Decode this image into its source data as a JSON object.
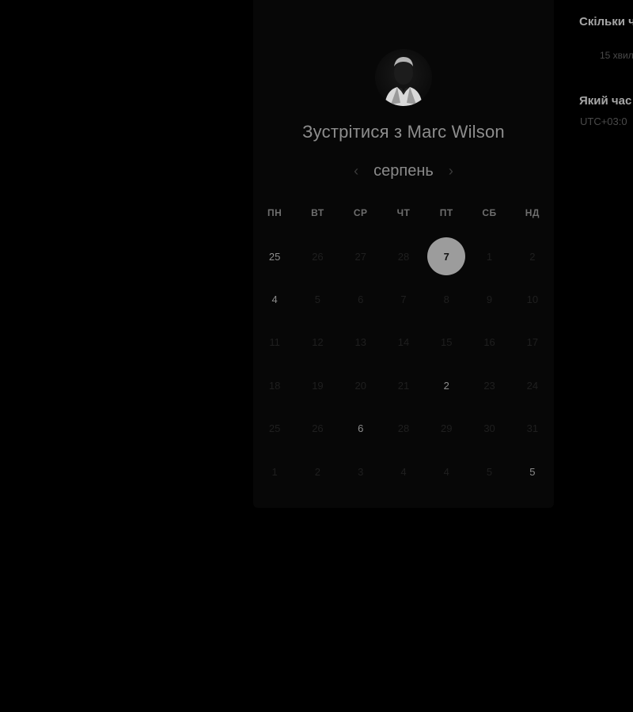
{
  "header": {
    "title_prefix": "Зустрітися з",
    "host_name": "Marc Wilson"
  },
  "calendar": {
    "month_label": "серпень",
    "prev_icon": "chevron-left-icon",
    "next_icon": "chevron-right-icon",
    "weekdays": [
      "ПН",
      "ВТ",
      "СР",
      "ЧТ",
      "ПТ",
      "СБ",
      "НД"
    ],
    "weeks": [
      [
        {
          "d": "25",
          "s": "available"
        },
        {
          "d": "26",
          "s": "disabled"
        },
        {
          "d": "27",
          "s": "disabled"
        },
        {
          "d": "28",
          "s": "disabled"
        },
        {
          "d": "7",
          "s": "selected"
        },
        {
          "d": "1",
          "s": "disabled"
        },
        {
          "d": "2",
          "s": "disabled"
        }
      ],
      [
        {
          "d": "4",
          "s": "available"
        },
        {
          "d": "5",
          "s": "disabled"
        },
        {
          "d": "6",
          "s": "disabled"
        },
        {
          "d": "7",
          "s": "disabled"
        },
        {
          "d": "8",
          "s": "disabled"
        },
        {
          "d": "9",
          "s": "disabled"
        },
        {
          "d": "10",
          "s": "disabled"
        }
      ],
      [
        {
          "d": "11",
          "s": "disabled"
        },
        {
          "d": "12",
          "s": "disabled"
        },
        {
          "d": "13",
          "s": "disabled"
        },
        {
          "d": "14",
          "s": "disabled"
        },
        {
          "d": "15",
          "s": "disabled"
        },
        {
          "d": "16",
          "s": "disabled"
        },
        {
          "d": "17",
          "s": "disabled"
        }
      ],
      [
        {
          "d": "18",
          "s": "disabled"
        },
        {
          "d": "19",
          "s": "disabled"
        },
        {
          "d": "20",
          "s": "disabled"
        },
        {
          "d": "21",
          "s": "disabled"
        },
        {
          "d": "2",
          "s": "available"
        },
        {
          "d": "23",
          "s": "disabled"
        },
        {
          "d": "24",
          "s": "disabled"
        }
      ],
      [
        {
          "d": "25",
          "s": "disabled"
        },
        {
          "d": "26",
          "s": "disabled"
        },
        {
          "d": "6",
          "s": "available"
        },
        {
          "d": "28",
          "s": "disabled"
        },
        {
          "d": "29",
          "s": "disabled"
        },
        {
          "d": "30",
          "s": "disabled"
        },
        {
          "d": "31",
          "s": "disabled"
        }
      ],
      [
        {
          "d": "1",
          "s": "disabled"
        },
        {
          "d": "2",
          "s": "disabled"
        },
        {
          "d": "3",
          "s": "disabled"
        },
        {
          "d": "4",
          "s": "disabled"
        },
        {
          "d": "4",
          "s": "disabled"
        },
        {
          "d": "5",
          "s": "disabled"
        },
        {
          "d": "5",
          "s": "available"
        }
      ]
    ]
  },
  "side": {
    "duration_heading": "Скільки ч",
    "duration_value": "15 хвил",
    "timezone_heading": "Який час",
    "timezone_value": "UTC+03:0"
  },
  "colors": {
    "background": "#000000",
    "card": "#070707",
    "selected_day": "#9c9c9c"
  }
}
